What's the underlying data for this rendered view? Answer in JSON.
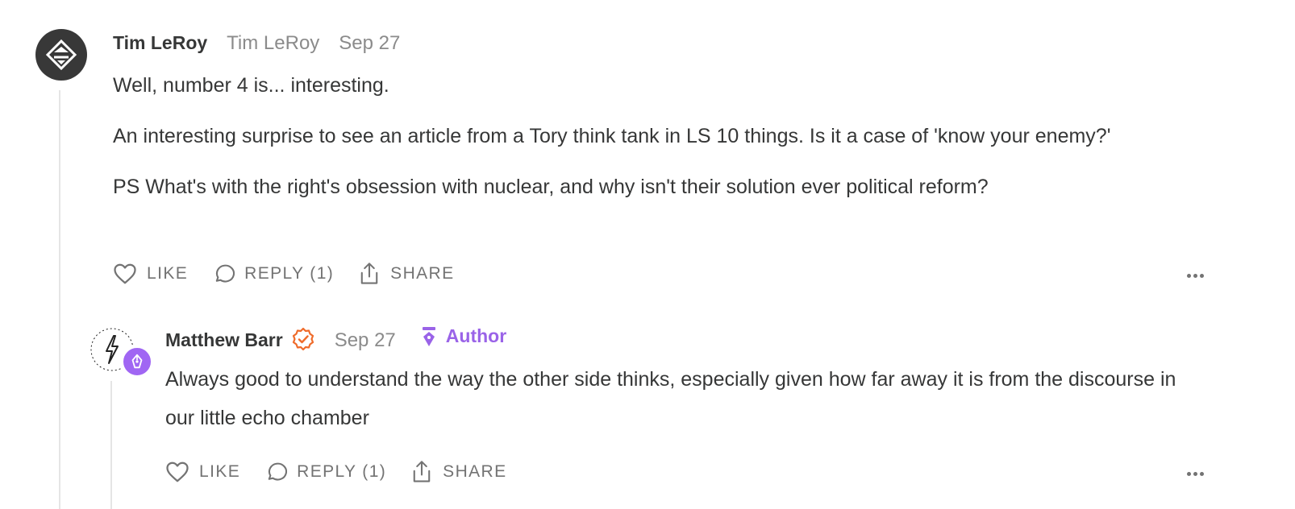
{
  "comments": [
    {
      "author": "Tim LeRoy",
      "handle": "Tim LeRoy",
      "date": "Sep 27",
      "paragraphs": [
        "Well, number 4 is... interesting.",
        "An interesting surprise to see an article from a Tory think tank in LS 10 things. Is it a case of 'know your enemy?'",
        "PS What's with the right's obsession with nuclear, and why isn't their solution ever political reform?"
      ],
      "actions": {
        "like": "LIKE",
        "reply": "REPLY (1)",
        "share": "SHARE"
      }
    },
    {
      "author": "Matthew Barr",
      "date": "Sep 27",
      "author_tag": "Author",
      "paragraphs": [
        "Always good to understand the way the other side thinks, especially given how far away it is from the discourse in our little echo chamber"
      ],
      "actions": {
        "like": "LIKE",
        "reply": "REPLY (1)",
        "share": "SHARE"
      }
    }
  ],
  "colors": {
    "accent_orange": "#ef6b2a",
    "author_purple": "#9a63e8",
    "muted": "#8b8b8b"
  },
  "icons": [
    "heart-icon",
    "comment-bubble-icon",
    "share-icon",
    "more-dots-icon",
    "verified-check-icon",
    "pen-nib-icon"
  ]
}
